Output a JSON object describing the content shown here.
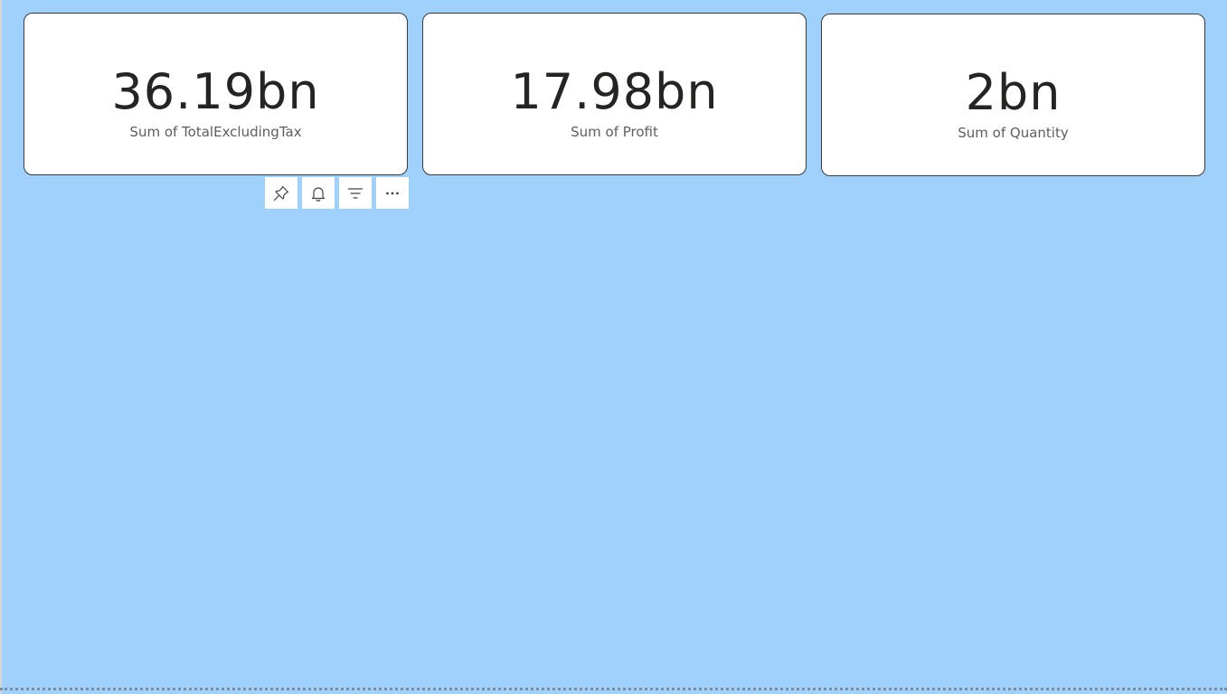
{
  "cards": [
    {
      "value": "36.19bn",
      "label": "Sum of TotalExcludingTax"
    },
    {
      "value": "17.98bn",
      "label": "Sum of Profit"
    },
    {
      "value": "2bn",
      "label": "Sum of Quantity"
    }
  ],
  "visual_toolbar": {
    "buttons": [
      {
        "icon": "pin-icon"
      },
      {
        "icon": "bell-icon"
      },
      {
        "icon": "filter-icon"
      },
      {
        "icon": "more-options-icon"
      }
    ]
  },
  "colors": {
    "canvas_background": "#a0d0fc",
    "card_background": "#ffffff",
    "value_text": "#252423",
    "label_text": "#605e5c"
  }
}
